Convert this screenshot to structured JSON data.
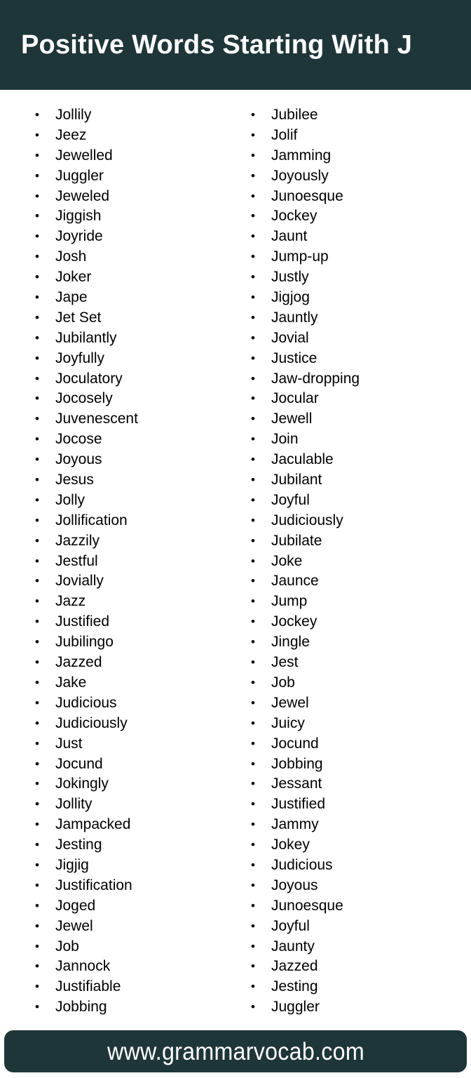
{
  "header": {
    "title": "Positive Words Starting With J",
    "background_color": "#1f3639",
    "text_color": "#ffffff"
  },
  "bullet_glyph": "•",
  "columns": [
    {
      "name": "left-column",
      "words": [
        "Jollily",
        "Jeez",
        "Jewelled",
        "Juggler",
        "Jeweled",
        "Jiggish",
        "Joyride",
        "Josh",
        "Joker",
        "Jape",
        "Jet Set",
        "Jubilantly",
        "Joyfully",
        "Joculatory",
        "Jocosely",
        "Juvenescent",
        "Jocose",
        "Joyous",
        "Jesus",
        "Jolly",
        "Jollification",
        "Jazzily",
        "Jestful",
        "Jovially",
        "Jazz",
        "Justified",
        "Jubilingo",
        "Jazzed",
        "Jake",
        "Judicious",
        "Judiciously",
        "Just",
        "Jocund",
        "Jokingly",
        "Jollity",
        "Jampacked",
        "Jesting",
        "Jigjig",
        "Justification",
        "Joged",
        "Jewel",
        "Job",
        "Jannock",
        "Justifiable",
        "Jobbing"
      ]
    },
    {
      "name": "right-column",
      "words": [
        "Jubilee",
        "Jolif",
        "Jamming",
        "Joyously",
        "Junoesque",
        "Jockey",
        "Jaunt",
        "Jump-up",
        "Justly",
        "Jigjog",
        "Jauntly",
        "Jovial",
        "Justice",
        "Jaw-dropping",
        "Jocular",
        "Jewell",
        "Join",
        "Jaculable",
        "Jubilant",
        "Joyful",
        "Judiciously",
        "Jubilate",
        "Joke",
        "Jaunce",
        "Jump",
        "Jockey",
        "Jingle",
        "Jest",
        "Job",
        "Jewel",
        "Juicy",
        "Jocund",
        "Jobbing",
        "Jessant",
        "Justified",
        "Jammy",
        "Jokey",
        "Judicious",
        "Joyous",
        "Junoesque",
        "Joyful",
        "Jaunty",
        "Jazzed",
        "Jesting",
        "Juggler"
      ]
    }
  ],
  "footer": {
    "url": "www.grammarvocab.com",
    "background_color": "#1f3639",
    "text_color": "#ffffff"
  }
}
